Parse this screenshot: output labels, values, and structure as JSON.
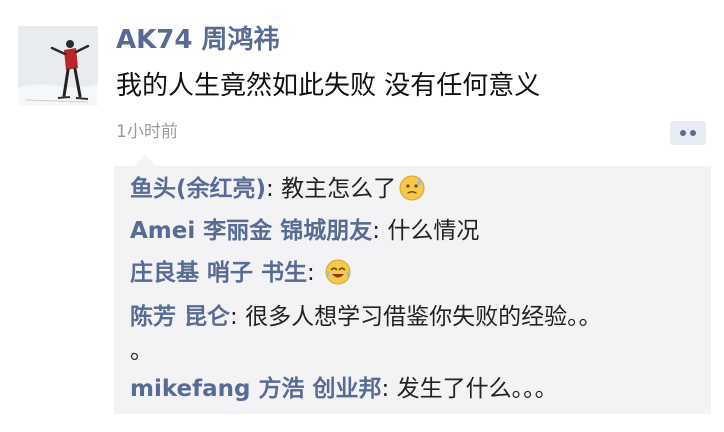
{
  "post": {
    "author": "AK74 周鸿祎",
    "text": "我的人生竟然如此失败 没有任何意义",
    "time": "1小时前",
    "more_icon": "more-dots-icon"
  },
  "comments": [
    {
      "name": "鱼头(余红亮)",
      "text": "教主怎么了",
      "emoji": "sweat-face-icon"
    },
    {
      "name": "Amei 李丽金 锦城朋友",
      "text": "什么情况"
    },
    {
      "name": "庄良基 哨子 书生",
      "text": "",
      "emoji": "laughing-tears-face-icon"
    },
    {
      "name": "陈芳 昆仑",
      "text": "很多人想学习借鉴你失败的经验。。",
      "continuation": "。"
    },
    {
      "name": "mikefang 方浩 创业邦",
      "text": "发生了什么。。。"
    }
  ],
  "colors": {
    "link": "#576b95",
    "text": "#111111",
    "muted": "#9a9a9a",
    "comment_bg": "#f3f3f5"
  }
}
